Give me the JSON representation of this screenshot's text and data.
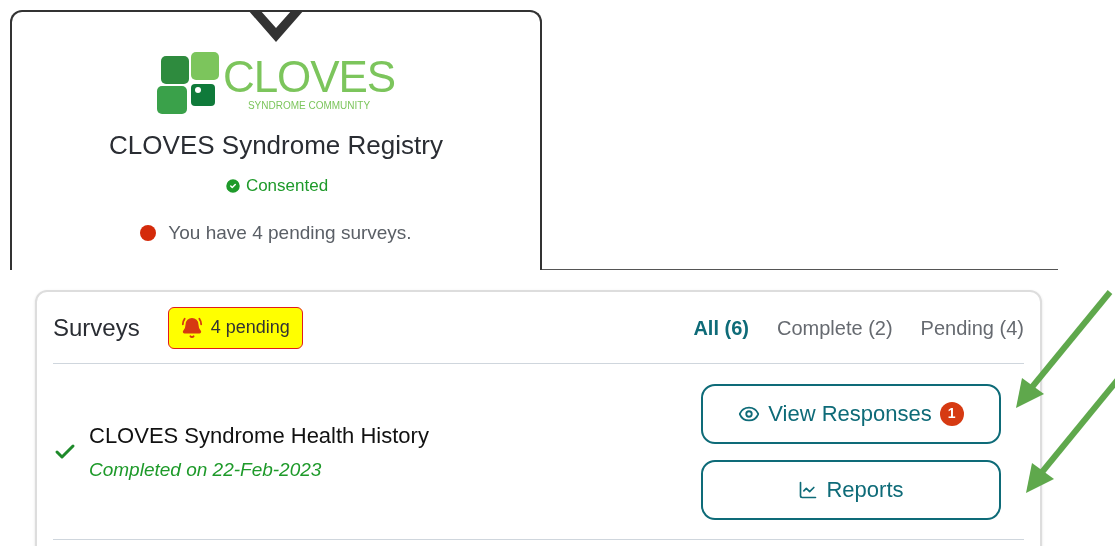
{
  "program": {
    "logo": {
      "name": "CLOVES",
      "tagline": "SYNDROME COMMUNITY"
    },
    "title": "CLOVES Syndrome Registry",
    "consent": "Consented",
    "pending_notice": "You have 4 pending surveys."
  },
  "surveys": {
    "title": "Surveys",
    "pending_badge": "4 pending",
    "tabs": [
      {
        "label": "All (6)",
        "selected": true
      },
      {
        "label": "Complete (2)",
        "selected": false
      },
      {
        "label": "Pending (4)",
        "selected": false
      }
    ],
    "items": [
      {
        "name": "CLOVES Syndrome Health History",
        "completed": true,
        "date_text": "Completed on 22-Feb-2023",
        "actions": [
          {
            "kind": "view",
            "label": "View Responses",
            "badge": "1"
          },
          {
            "kind": "reports",
            "label": "Reports"
          }
        ]
      }
    ]
  },
  "annotations": [
    {
      "kind": "arrow"
    },
    {
      "kind": "arrow"
    }
  ]
}
